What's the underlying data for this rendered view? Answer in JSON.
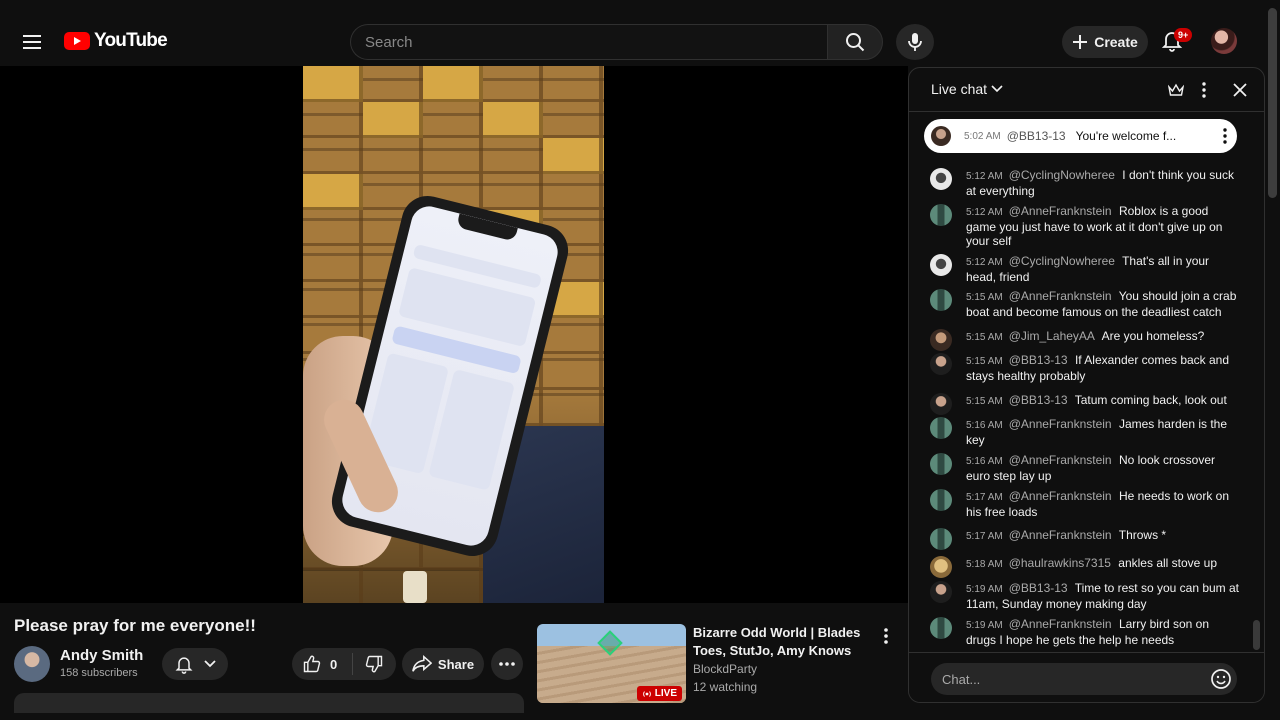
{
  "app": {
    "logo_text": "YouTube",
    "accent_color": "#ff0000"
  },
  "search": {
    "placeholder": "Search",
    "value": ""
  },
  "header": {
    "create_label": "Create",
    "notifications_badge": "9+"
  },
  "video": {
    "title": "Please pray for me everyone!!",
    "channel_name": "Andy Smith",
    "subscribers": "158 subscribers",
    "like_count": "0",
    "share_label": "Share"
  },
  "recommended": {
    "title": "Bizarre Odd World | Blades Toes, StutJo, Amy Knows",
    "channel": "BlockdParty",
    "watching": "12 watching",
    "live_label": "LIVE"
  },
  "chat": {
    "header_title": "Live chat",
    "input_placeholder": "Chat...",
    "pinned": {
      "time": "5:02 AM",
      "author": "@BB13-13",
      "text": "You're welcome f..."
    },
    "messages": [
      {
        "time": "5:12 AM",
        "author": "@CyclingNowheree",
        "text": "I don't think you suck at everything",
        "avatar": "bike"
      },
      {
        "time": "5:12 AM",
        "author": "@AnneFranknstein",
        "text": "Roblox is a good game you just have to work at it don't give up on your self",
        "avatar": "anne"
      },
      {
        "time": "5:12 AM",
        "author": "@CyclingNowheree",
        "text": "That's all in your head, friend",
        "avatar": "bike"
      },
      {
        "time": "5:15 AM",
        "author": "@AnneFranknstein",
        "text": "You should join a crab boat and become famous on the deadliest catch",
        "avatar": "anne"
      },
      {
        "time": "5:15 AM",
        "author": "@Jim_LaheyAA",
        "text": "Are you homeless?",
        "avatar": "jim"
      },
      {
        "time": "5:15 AM",
        "author": "@BB13-13",
        "text": "If Alexander comes back and stays healthy probably",
        "avatar": "bb"
      },
      {
        "time": "5:15 AM",
        "author": "@BB13-13",
        "text": "Tatum coming back, look out",
        "avatar": "bb"
      },
      {
        "time": "5:16 AM",
        "author": "@AnneFranknstein",
        "text": "James harden is the key",
        "avatar": "anne"
      },
      {
        "time": "5:16 AM",
        "author": "@AnneFranknstein",
        "text": "No look crossover euro step lay up",
        "avatar": "anne"
      },
      {
        "time": "5:17 AM",
        "author": "@AnneFranknstein",
        "text": "He needs to work on his free loads",
        "avatar": "anne"
      },
      {
        "time": "5:17 AM",
        "author": "@AnneFranknstein",
        "text": "Throws *",
        "avatar": "anne"
      },
      {
        "time": "5:18 AM",
        "author": "@haulrawkins7315",
        "text": "ankles all stove up",
        "avatar": "haul"
      },
      {
        "time": "5:19 AM",
        "author": "@BB13-13",
        "text": "Time to rest so you can bum at 11am, Sunday money making day",
        "avatar": "bb"
      },
      {
        "time": "5:19 AM",
        "author": "@AnneFranknstein",
        "text": "Larry bird son on drugs I hope he gets the help he needs",
        "avatar": "anne"
      }
    ]
  }
}
